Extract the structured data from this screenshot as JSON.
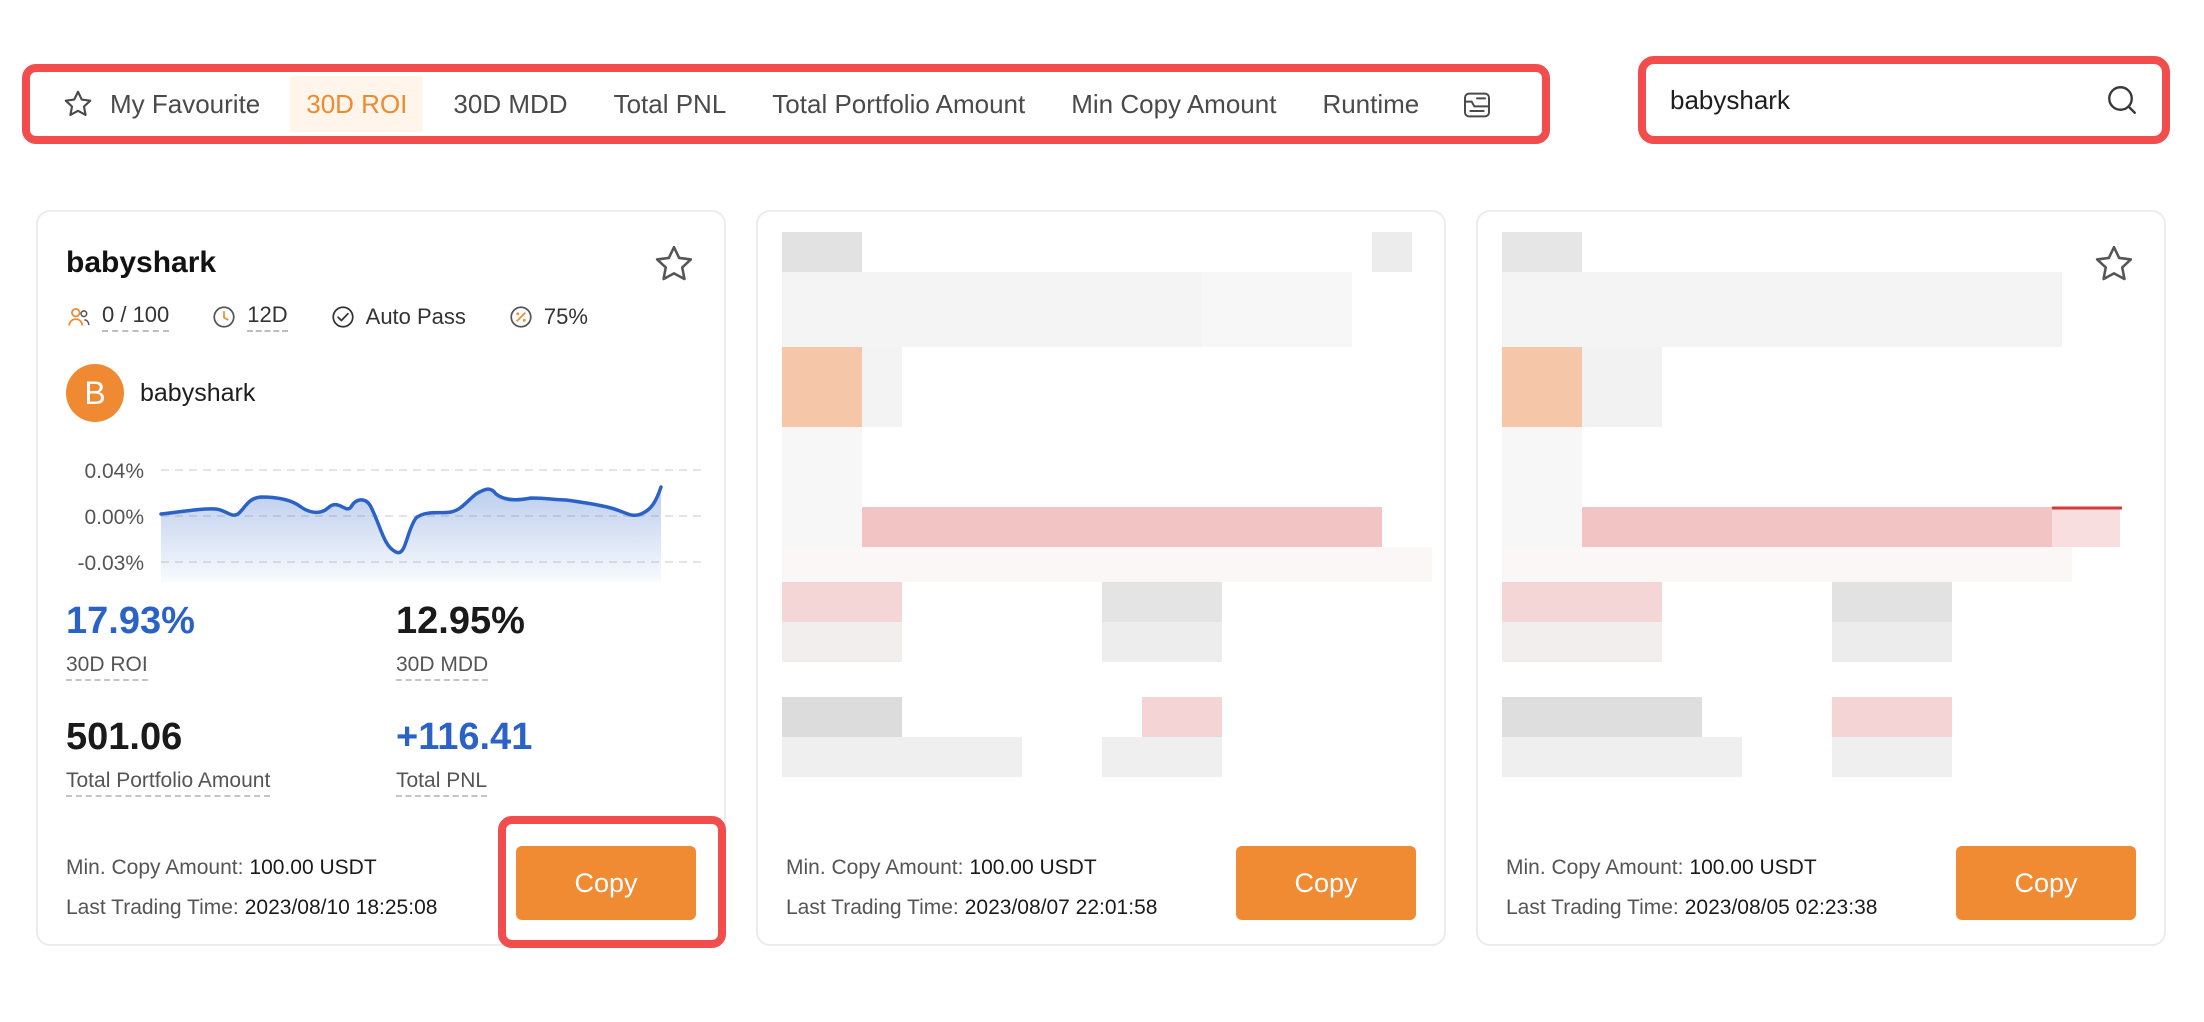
{
  "filters": {
    "tabs": [
      {
        "label": "My Favourite",
        "active": false
      },
      {
        "label": "30D ROI",
        "active": true
      },
      {
        "label": "30D MDD",
        "active": false
      },
      {
        "label": "Total PNL",
        "active": false
      },
      {
        "label": "Total Portfolio Amount",
        "active": false
      },
      {
        "label": "Min Copy Amount",
        "active": false
      },
      {
        "label": "Runtime",
        "active": false
      }
    ]
  },
  "search": {
    "value": "babyshark"
  },
  "colors": {
    "accent": "#f08a33",
    "highlight": "#f24c4c",
    "blue": "#2a62c6"
  },
  "cards": [
    {
      "title": "babyshark",
      "followers": "0 / 100",
      "runtime": "12D",
      "auto_pass": "Auto Pass",
      "profit_share": "75%",
      "avatar_letter": "B",
      "trader": "babyshark",
      "chart_ticks": [
        "0.04%",
        "0.00%",
        "-0.03%"
      ],
      "roi_value": "17.93%",
      "roi_label": "30D ROI",
      "mdd_value": "12.95%",
      "mdd_label": "30D MDD",
      "portfolio_value": "501.06",
      "portfolio_label": "Total Portfolio Amount",
      "pnl_value": "+116.41",
      "pnl_label": "Total PNL",
      "min_copy_label": "Min. Copy Amount:",
      "min_copy_value": "100.00 USDT",
      "last_trade_label": "Last Trading Time:",
      "last_trade_value": "2023/08/10 18:25:08",
      "copy_label": "Copy"
    },
    {
      "min_copy_label": "Min. Copy Amount:",
      "min_copy_value": "100.00 USDT",
      "last_trade_label": "Last Trading Time:",
      "last_trade_value": "2023/08/07 22:01:58",
      "copy_label": "Copy"
    },
    {
      "min_copy_label": "Min. Copy Amount:",
      "min_copy_value": "100.00 USDT",
      "last_trade_label": "Last Trading Time:",
      "last_trade_value": "2023/08/05 02:23:38",
      "copy_label": "Copy"
    }
  ]
}
